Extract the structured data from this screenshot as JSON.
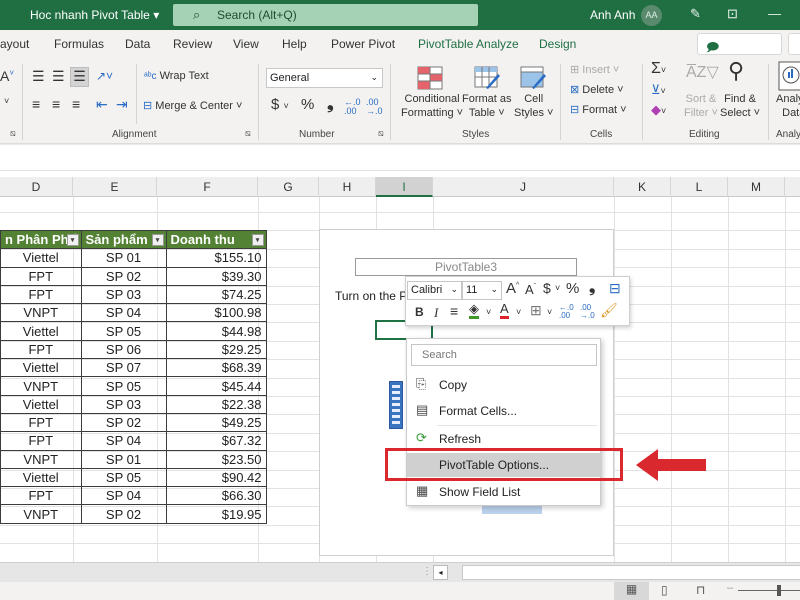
{
  "titlebar": {
    "document_title": "Hoc nhanh Pivot Table",
    "search_placeholder": "Search (Alt+Q)",
    "user_name": "Anh Anh",
    "user_initials": "AA"
  },
  "tabs": [
    {
      "label": "ayout"
    },
    {
      "label": "Formulas"
    },
    {
      "label": "Data"
    },
    {
      "label": "Review"
    },
    {
      "label": "View"
    },
    {
      "label": "Help"
    },
    {
      "label": "Power Pivot"
    },
    {
      "label": "PivotTable Analyze"
    },
    {
      "label": "Design"
    }
  ],
  "comments_label": "Comments",
  "ribbon": {
    "alignment": {
      "wrap_text": "Wrap Text",
      "merge_center": "Merge & Center",
      "label": "Alignment"
    },
    "number": {
      "format_value": "General",
      "currency": "$",
      "percent": "%",
      "comma": "❟",
      "label": "Number"
    },
    "styles": {
      "conditional_formatting": [
        "Conditional",
        "Formatting ˅"
      ],
      "format_as_table": [
        "Format as",
        "Table ˅"
      ],
      "cell_styles": [
        "Cell",
        "Styles ˅"
      ],
      "label": "Styles"
    },
    "cells": {
      "insert": "Insert",
      "delete": "Delete",
      "format": "Format",
      "label": "Cells"
    },
    "editing": {
      "sort_filter": [
        "Sort &",
        "Filter ˅"
      ],
      "find_select": [
        "Find &",
        "Select ˅"
      ],
      "label": "Editing"
    },
    "analysis": {
      "analyze_data": [
        "Analy",
        "Data"
      ],
      "label": "Analys"
    }
  },
  "columns": [
    "D",
    "E",
    "F",
    "G",
    "H",
    "I",
    "J",
    "K",
    "L",
    "M"
  ],
  "selected_column": "I",
  "table": {
    "headers": [
      "Nhà Phân Phối",
      "Sản phẩm",
      "Doanh thu"
    ],
    "header_display": [
      "n Phân Phố",
      "Sản phẩm",
      "Doanh thu"
    ],
    "rows": [
      [
        "Viettel",
        "SP 01",
        "$155.10"
      ],
      [
        "FPT",
        "SP 02",
        "$39.30"
      ],
      [
        "FPT",
        "SP 03",
        "$74.25"
      ],
      [
        "VNPT",
        "SP 04",
        "$100.98"
      ],
      [
        "Viettel",
        "SP 05",
        "$44.98"
      ],
      [
        "FPT",
        "SP 06",
        "$29.25"
      ],
      [
        "Viettel",
        "SP 07",
        "$68.39"
      ],
      [
        "VNPT",
        "SP 05",
        "$45.44"
      ],
      [
        "Viettel",
        "SP 03",
        "$22.38"
      ],
      [
        "FPT",
        "SP 02",
        "$49.25"
      ],
      [
        "FPT",
        "SP 04",
        "$67.32"
      ],
      [
        "VNPT",
        "SP 01",
        "$23.50"
      ],
      [
        "Viettel",
        "SP 05",
        "$90.42"
      ],
      [
        "FPT",
        "SP 04",
        "$66.30"
      ],
      [
        "VNPT",
        "SP 02",
        "$19.95"
      ]
    ]
  },
  "pivot": {
    "name": "PivotTable3",
    "hint": "Turn on the P"
  },
  "mini_toolbar": {
    "font": "Calibri",
    "size": "11",
    "bold": "B",
    "italic": "I"
  },
  "context_menu": {
    "search_placeholder": "Search",
    "items": [
      {
        "label": "Copy",
        "icon": "copy-icon"
      },
      {
        "label": "Format Cells...",
        "icon": "format-cells-icon"
      },
      {
        "label": "Refresh",
        "icon": "refresh-icon"
      },
      {
        "label": "PivotTable Options...",
        "icon": "none",
        "highlighted": true
      },
      {
        "label": "Show Field List",
        "icon": "field-list-icon"
      }
    ]
  },
  "colors": {
    "excel_green": "#1f6f43",
    "header_fill": "#548235",
    "annotation_red": "#d9282e",
    "pivot_blue": "#3a73c0"
  }
}
